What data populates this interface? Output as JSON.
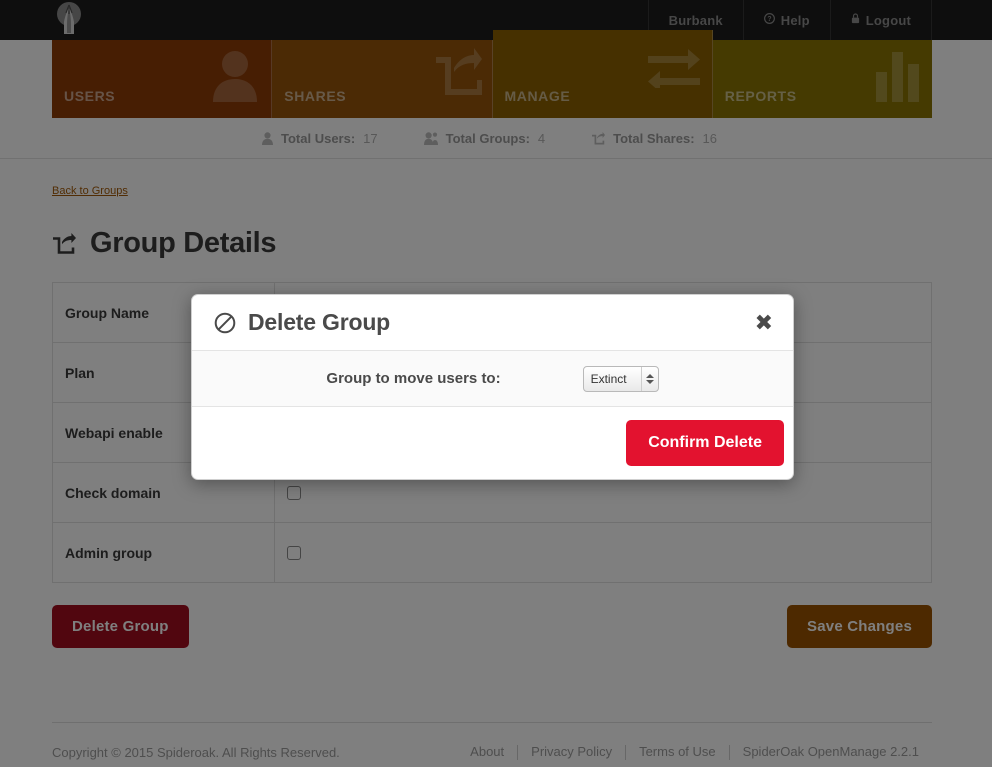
{
  "header": {
    "logo_name": "spideroak-keyhole-logo",
    "account": "Burbank",
    "help": "Help",
    "logout": "Logout"
  },
  "nav_tiles": [
    {
      "label": "USERS",
      "icon": "user-icon",
      "color": "#8f3c06",
      "active": false
    },
    {
      "label": "SHARES",
      "icon": "share-icon",
      "color": "#96550a",
      "active": false
    },
    {
      "label": "MANAGE",
      "icon": "exchange-icon",
      "color": "#8d6100",
      "active": true
    },
    {
      "label": "REPORTS",
      "icon": "bar-chart-icon",
      "color": "#8a7402",
      "active": false
    }
  ],
  "stats": [
    {
      "icon": "user-icon",
      "label": "Total Users:",
      "value": "17"
    },
    {
      "icon": "users-icon",
      "label": "Total Groups:",
      "value": "4"
    },
    {
      "icon": "share-icon",
      "label": "Total Shares:",
      "value": "16"
    }
  ],
  "breadcrumb": {
    "back_label": "Back to Groups"
  },
  "page": {
    "title": "Group Details",
    "title_icon": "share-icon"
  },
  "form": {
    "rows": [
      {
        "label": "Group Name",
        "control": "text",
        "value": ""
      },
      {
        "label": "Plan",
        "control": "select",
        "value": ""
      },
      {
        "label": "Webapi enable",
        "control": "checkbox",
        "value": ""
      },
      {
        "label": "Check domain",
        "control": "checkbox",
        "value": ""
      },
      {
        "label": "Admin group",
        "control": "checkbox",
        "value": ""
      }
    ]
  },
  "actions": {
    "delete_label": "Delete Group",
    "save_label": "Save Changes",
    "delete_color": "#a30d1f",
    "save_color": "#9a5300"
  },
  "modal": {
    "title": "Delete Group",
    "title_icon": "ban-icon",
    "close_icon": "✖",
    "field_label": "Group to move users to:",
    "select_value": "Extinct",
    "confirm_label": "Confirm Delete",
    "confirm_color": "#e3122f"
  },
  "footer": {
    "copyright": "Copyright © 2015 Spideroak. All Rights Reserved.",
    "links": [
      {
        "label": "About"
      },
      {
        "label": "Privacy Policy"
      },
      {
        "label": "Terms of Use"
      }
    ],
    "version": "SpiderOak OpenManage 2.2.1"
  }
}
